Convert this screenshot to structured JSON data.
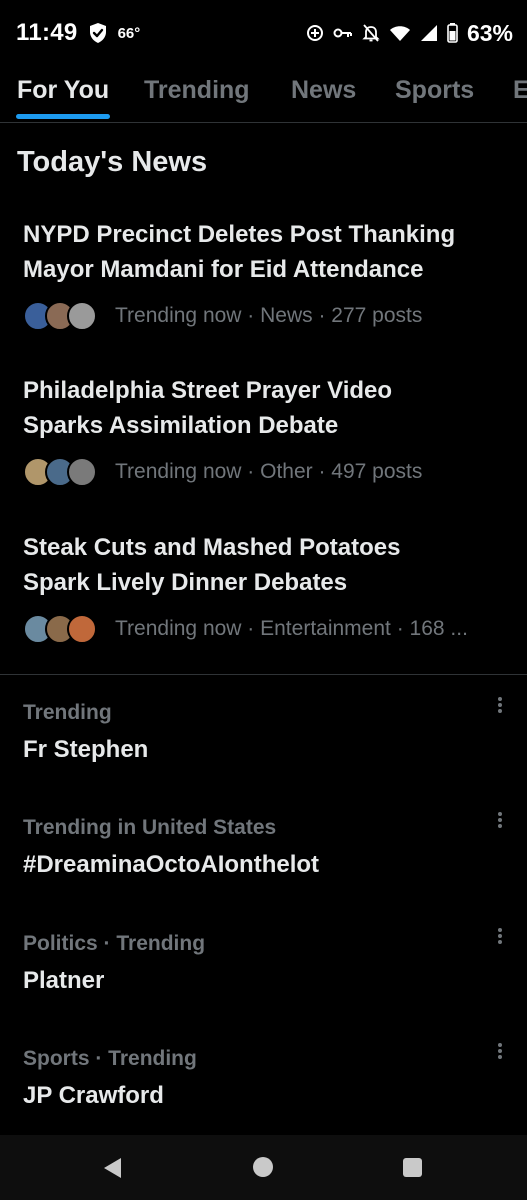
{
  "status_bar": {
    "time": "11:49",
    "temperature": "66°",
    "battery": "63%"
  },
  "tabs": [
    {
      "label": "For You",
      "active": true
    },
    {
      "label": "Trending",
      "active": false
    },
    {
      "label": "News",
      "active": false
    },
    {
      "label": "Sports",
      "active": false
    },
    {
      "label": "E",
      "active": false
    }
  ],
  "todays_news": {
    "title": "Today's News",
    "items": [
      {
        "headline_line1": "NYPD Precinct Deletes Post Thanking",
        "headline_line2": "Mayor Mamdani for Eid Attendance",
        "meta": "Trending now · News · 277 posts",
        "avatar_colors": [
          "#3a5f9a",
          "#8a6a55",
          "#9a9a9a"
        ]
      },
      {
        "headline_line1": "Philadelphia Street Prayer Video",
        "headline_line2": "Sparks Assimilation Debate",
        "meta": "Trending now · Other · 497 posts",
        "avatar_colors": [
          "#b0966a",
          "#4a6a8a",
          "#7a7a7a"
        ]
      },
      {
        "headline_line1": "Steak Cuts and Mashed Potatoes",
        "headline_line2": "Spark Lively Dinner Debates",
        "meta": "Trending now · Entertainment · 168 ...",
        "avatar_colors": [
          "#6a8aa0",
          "#8a6a4a",
          "#c0683a"
        ]
      }
    ]
  },
  "trends": [
    {
      "context": "Trending",
      "name": "Fr Stephen"
    },
    {
      "context": "Trending in United States",
      "name": "#DreaminaOctoAIonthelot"
    },
    {
      "context": "Politics · Trending",
      "name": "Platner"
    },
    {
      "context": "Sports · Trending",
      "name": "JP Crawford"
    }
  ],
  "colors": {
    "accent": "#1d9bf0",
    "background": "#000000",
    "primary_text": "#e7e9ea",
    "secondary_text": "#71767b"
  }
}
